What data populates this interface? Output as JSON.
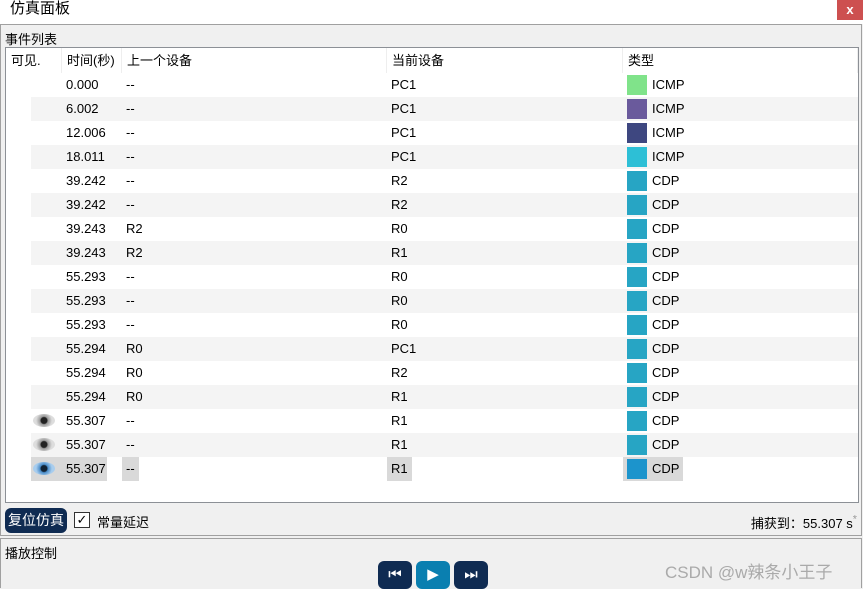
{
  "window": {
    "title": "仿真面板",
    "close": "x"
  },
  "events": {
    "label": "事件列表",
    "columns": [
      "可见.",
      "时间(秒)",
      "上一个设备",
      "当前设备",
      "类型"
    ],
    "rows": [
      {
        "eye": "",
        "time": "0.000",
        "prev": "--",
        "cur": "PC1",
        "type": "ICMP",
        "color": "#80e38a"
      },
      {
        "eye": "",
        "time": "6.002",
        "prev": "--",
        "cur": "PC1",
        "type": "ICMP",
        "color": "#6a5a9c"
      },
      {
        "eye": "",
        "time": "12.006",
        "prev": "--",
        "cur": "PC1",
        "type": "ICMP",
        "color": "#3e4780"
      },
      {
        "eye": "",
        "time": "18.011",
        "prev": "--",
        "cur": "PC1",
        "type": "ICMP",
        "color": "#2dbfd6"
      },
      {
        "eye": "",
        "time": "39.242",
        "prev": "--",
        "cur": "R2",
        "type": "CDP",
        "color": "#27a5c4"
      },
      {
        "eye": "",
        "time": "39.242",
        "prev": "--",
        "cur": "R2",
        "type": "CDP",
        "color": "#27a5c4"
      },
      {
        "eye": "",
        "time": "39.243",
        "prev": "R2",
        "cur": "R0",
        "type": "CDP",
        "color": "#27a5c4"
      },
      {
        "eye": "",
        "time": "39.243",
        "prev": "R2",
        "cur": "R1",
        "type": "CDP",
        "color": "#27a5c4"
      },
      {
        "eye": "",
        "time": "55.293",
        "prev": "--",
        "cur": "R0",
        "type": "CDP",
        "color": "#27a5c4"
      },
      {
        "eye": "",
        "time": "55.293",
        "prev": "--",
        "cur": "R0",
        "type": "CDP",
        "color": "#27a5c4"
      },
      {
        "eye": "",
        "time": "55.293",
        "prev": "--",
        "cur": "R0",
        "type": "CDP",
        "color": "#27a5c4"
      },
      {
        "eye": "",
        "time": "55.294",
        "prev": "R0",
        "cur": "PC1",
        "type": "CDP",
        "color": "#27a5c4"
      },
      {
        "eye": "",
        "time": "55.294",
        "prev": "R0",
        "cur": "R2",
        "type": "CDP",
        "color": "#27a5c4"
      },
      {
        "eye": "",
        "time": "55.294",
        "prev": "R0",
        "cur": "R1",
        "type": "CDP",
        "color": "#27a5c4"
      },
      {
        "eye": "gray",
        "time": "55.307",
        "prev": "--",
        "cur": "R1",
        "type": "CDP",
        "color": "#27a5c4"
      },
      {
        "eye": "gray",
        "time": "55.307",
        "prev": "--",
        "cur": "R1",
        "type": "CDP",
        "color": "#27a5c4"
      },
      {
        "eye": "blue",
        "time": "55.307",
        "prev": "--",
        "cur": "R1",
        "type": "CDP",
        "color": "#1c94cc",
        "selected": true
      }
    ]
  },
  "controls": {
    "reset": "复位仿真",
    "constant_delay": "常量延迟",
    "checked": true,
    "captured_label": "捕获到：",
    "captured_value": "55.307 s",
    "asterisk": "*"
  },
  "playback": {
    "label": "播放控制",
    "back": "⏮",
    "play": "▶",
    "forward": "⏭"
  },
  "watermark": "CSDN @w辣条小王子"
}
